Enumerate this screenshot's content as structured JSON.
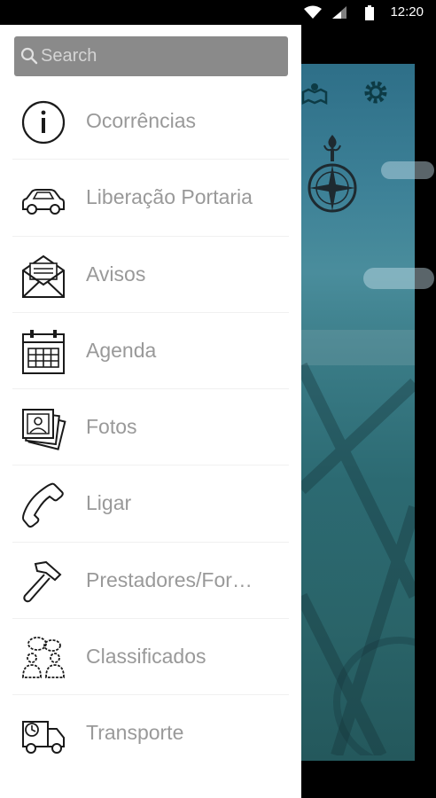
{
  "status_bar": {
    "time": "12:20"
  },
  "search": {
    "placeholder": "Search",
    "value": ""
  },
  "menu": {
    "items": [
      {
        "label": "Ocorrências",
        "icon": "info-icon"
      },
      {
        "label": "Liberação Portaria",
        "icon": "car-icon"
      },
      {
        "label": "Avisos",
        "icon": "envelope-icon"
      },
      {
        "label": "Agenda",
        "icon": "calendar-icon"
      },
      {
        "label": "Fotos",
        "icon": "photos-icon"
      },
      {
        "label": "Ligar",
        "icon": "phone-icon"
      },
      {
        "label": "Prestadores/For…",
        "icon": "hammer-icon"
      },
      {
        "label": "Classificados",
        "icon": "people-chat-icon"
      },
      {
        "label": "Transporte",
        "icon": "truck-icon"
      }
    ]
  },
  "colors": {
    "drawer_bg": "#ffffff",
    "label": "#999999",
    "search_bg": "#8a8a8a"
  }
}
